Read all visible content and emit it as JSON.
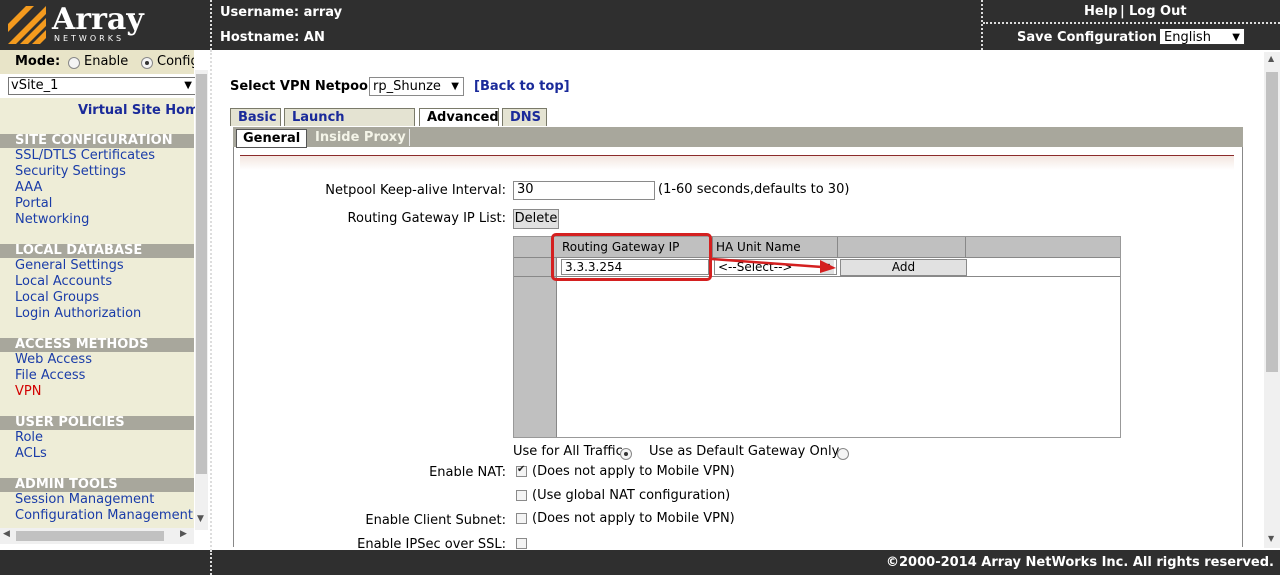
{
  "brand": {
    "name": "Array",
    "sub": "NETWORKS"
  },
  "header": {
    "username_label": "Username: array",
    "hostname_label": "Hostname: AN",
    "help": "Help",
    "separator": "|",
    "logout": "Log Out",
    "save_config": "Save Configuration",
    "language": "English"
  },
  "sidebar": {
    "mode_label": "Mode:",
    "mode_enable": "Enable",
    "mode_config": "Config",
    "vsite": "vSite_1",
    "vsite_home": "Virtual Site Home",
    "sections": [
      {
        "title": "SITE CONFIGURATION",
        "items": [
          "SSL/DTLS Certificates",
          "Security Settings",
          "AAA",
          "Portal",
          "Networking"
        ]
      },
      {
        "title": "LOCAL DATABASE",
        "items": [
          "General Settings",
          "Local Accounts",
          "Local Groups",
          "Login Authorization"
        ]
      },
      {
        "title": "ACCESS METHODS",
        "items": [
          "Web Access",
          "File Access",
          "VPN"
        ]
      },
      {
        "title": "USER POLICIES",
        "items": [
          "Role",
          "ACLs"
        ]
      },
      {
        "title": "ADMIN TOOLS",
        "items": [
          "Session Management",
          "Configuration Management"
        ]
      }
    ]
  },
  "main": {
    "netpool_label": "Select VPN Netpool:",
    "netpool_value": "rp_Shunze",
    "back_to_top": "[Back to top]",
    "tabs": [
      "Basic",
      "Launch Command",
      "Advanced",
      "DNS"
    ],
    "subtabs": [
      "General",
      "Inside Proxy"
    ],
    "keepalive_label": "Netpool Keep-alive Interval:",
    "keepalive_value": "30",
    "keepalive_hint": "(1-60 seconds,defaults to 30)",
    "gateway_list_label": "Routing Gateway IP List:",
    "delete_button": "Delete",
    "grid": {
      "col_ip": "Routing Gateway IP",
      "col_ha": "HA Unit Name",
      "ip_value": "3.3.3.254",
      "ha_value": "<--Select-->",
      "add_button": "Add"
    },
    "use_all_traffic": "Use for All Traffic",
    "use_default_gw": "Use as Default Gateway Only",
    "enable_nat_label": "Enable NAT:",
    "nat_mobile": "(Does not apply to Mobile VPN)",
    "nat_global": "(Use global NAT configuration)",
    "client_subnet_label": "Enable Client Subnet:",
    "client_subnet_mobile": "(Does not apply to Mobile VPN)",
    "ipsec_label": "Enable IPSec over SSL:"
  },
  "footer": {
    "copyright": "©2000-2014 Array NetWorks Inc. All rights reserved."
  },
  "colors": {
    "accent_orange": "#f39a1e",
    "link_blue": "#1a3ca8",
    "active_red": "#d20000",
    "annotation_red": "#d42020",
    "dark_bar": "#2f2f2f"
  }
}
